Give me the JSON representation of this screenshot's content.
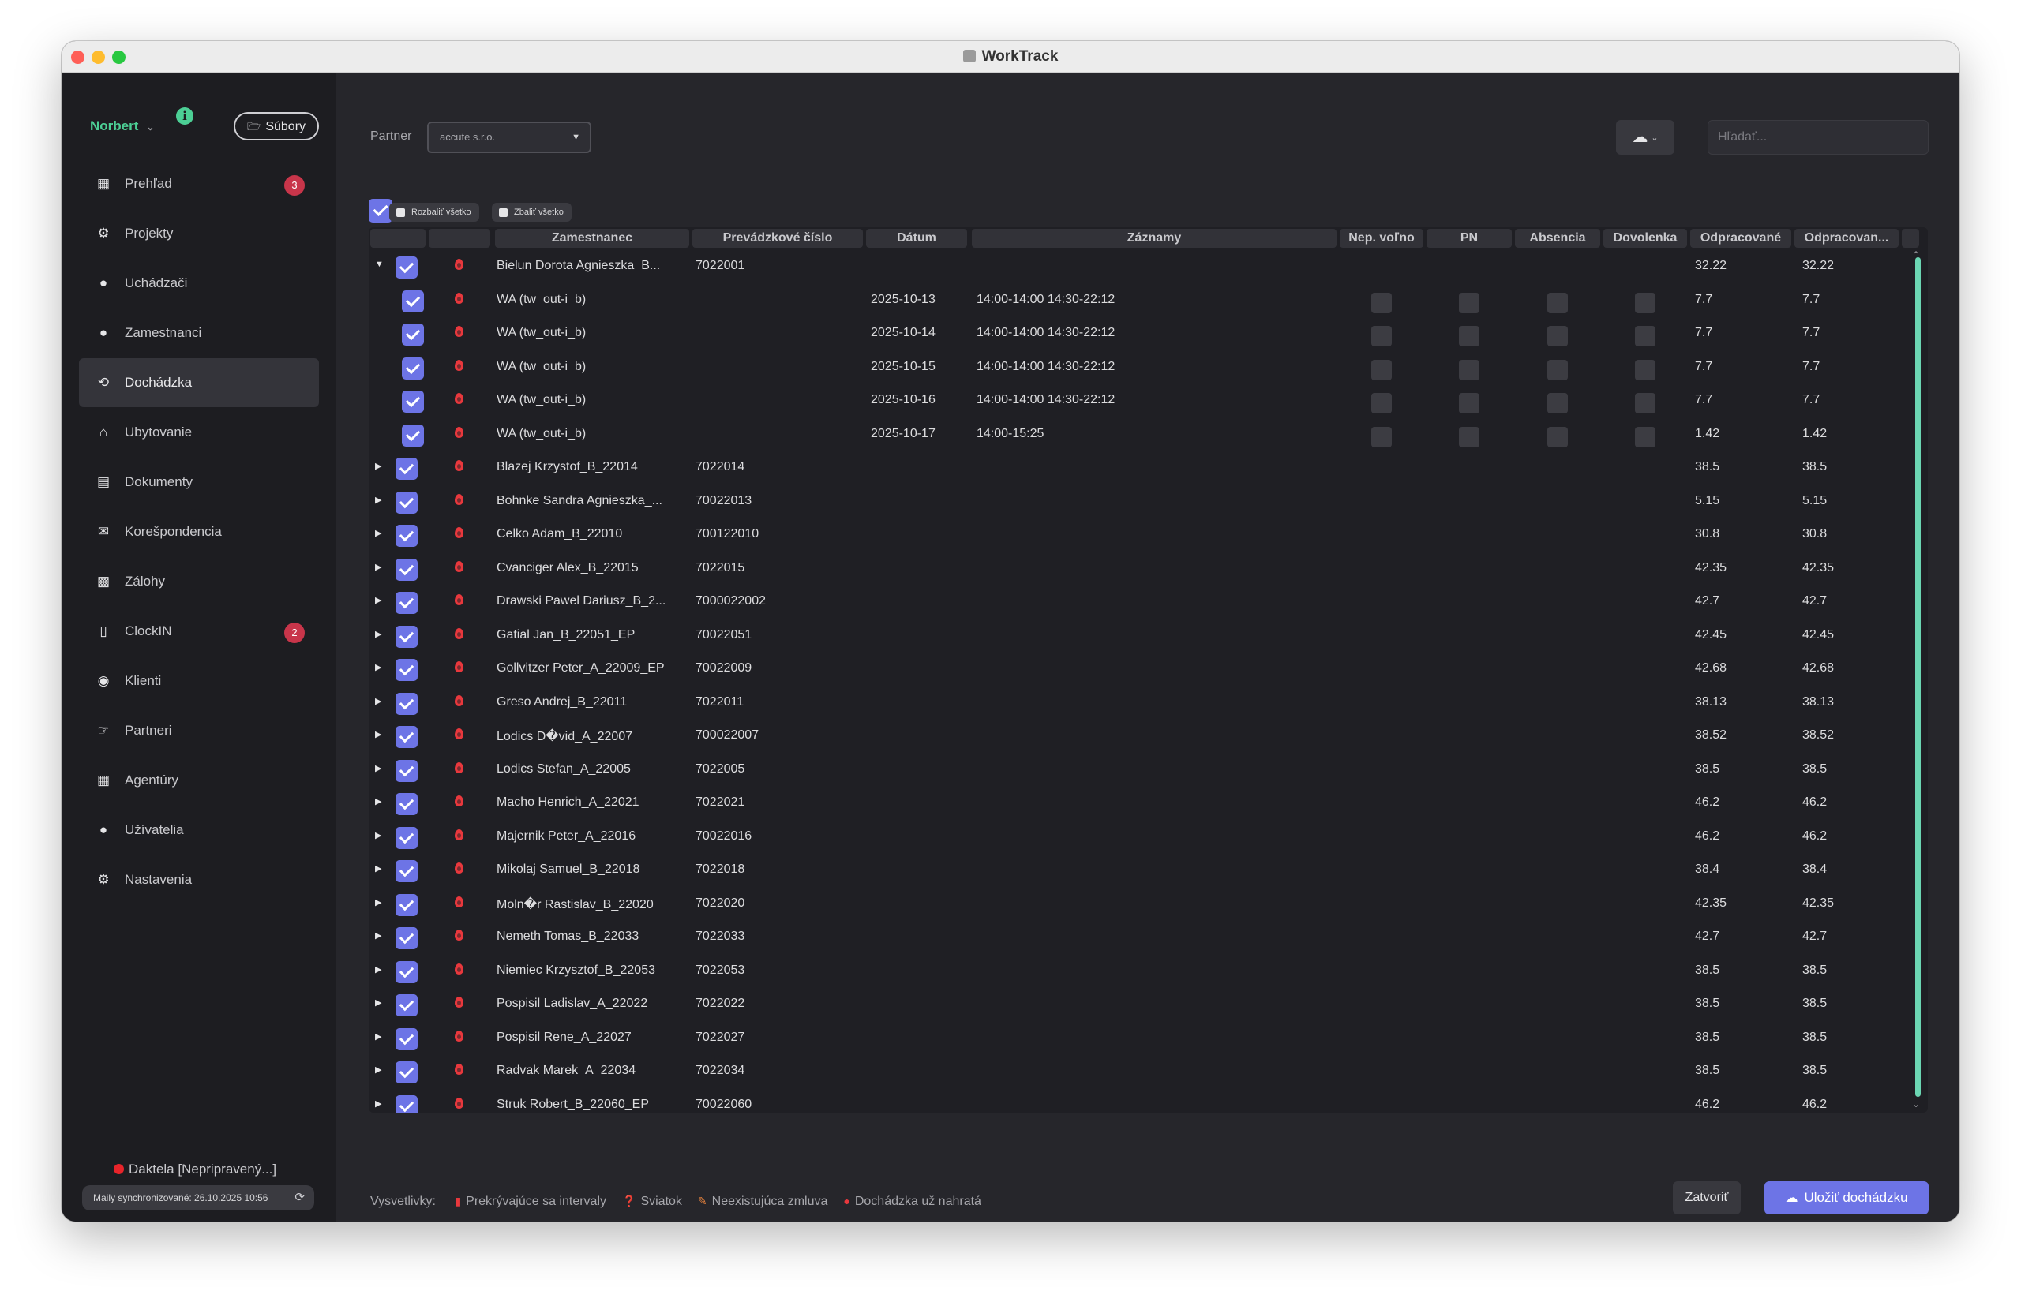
{
  "window": {
    "title": "WorkTrack"
  },
  "sidebar": {
    "user": "Norbert",
    "files_label": "Súbory",
    "items": [
      {
        "label": "Prehľad",
        "icon": "grid-icon",
        "badge": "3",
        "active": false
      },
      {
        "label": "Projekty",
        "icon": "projects-icon",
        "badge": null,
        "active": false
      },
      {
        "label": "Uchádzači",
        "icon": "applicants-icon",
        "badge": null,
        "active": false
      },
      {
        "label": "Zamestnanci",
        "icon": "employees-icon",
        "badge": null,
        "active": false
      },
      {
        "label": "Dochádzka",
        "icon": "history-icon",
        "badge": null,
        "active": true
      },
      {
        "label": "Ubytovanie",
        "icon": "house-icon",
        "badge": null,
        "active": false
      },
      {
        "label": "Dokumenty",
        "icon": "documents-icon",
        "badge": null,
        "active": false
      },
      {
        "label": "Korešpondencia",
        "icon": "mail-icon",
        "badge": null,
        "active": false
      },
      {
        "label": "Zálohy",
        "icon": "money-icon",
        "badge": null,
        "active": false
      },
      {
        "label": "ClockIN",
        "icon": "phone-icon",
        "badge": "2",
        "active": false
      },
      {
        "label": "Klienti",
        "icon": "handshake-icon",
        "badge": null,
        "active": false
      },
      {
        "label": "Partneri",
        "icon": "partner-hand-icon",
        "badge": null,
        "active": false
      },
      {
        "label": "Agentúry",
        "icon": "building-icon",
        "badge": null,
        "active": false
      },
      {
        "label": "Užívatelia",
        "icon": "users-icon",
        "badge": null,
        "active": false
      },
      {
        "label": "Nastavenia",
        "icon": "gears-icon",
        "badge": null,
        "active": false
      }
    ],
    "daktela": "Daktela [Nepripravený...]",
    "sync": "Maily synchronizované: 26.10.2025 10:56"
  },
  "toolbar": {
    "partner_label": "Partner",
    "partner_value": "accute s.r.o.",
    "search_placeholder": "Hľadať..."
  },
  "actions": {
    "expand_all": "Rozbaliť všetko",
    "collapse_all": "Zbaliť všetko"
  },
  "table": {
    "columns": [
      "Zamestnanec",
      "Prevádzkové číslo",
      "Dátum",
      "Záznamy",
      "Nep. voľno",
      "PN",
      "Absencia",
      "Dovolenka",
      "Odpracované",
      "Odpracovan..."
    ],
    "rows": [
      {
        "kind": "parent",
        "expanded": true,
        "name": "Bielun Dorota Agnieszka_B...",
        "number": "7022001",
        "worked": "32.22",
        "worked2": "32.22"
      },
      {
        "kind": "child",
        "name": "WA (tw_out-i_b)",
        "date": "2025-10-13",
        "records": "14:00-14:00 14:30-22:12",
        "worked": "7.7",
        "worked2": "7.7"
      },
      {
        "kind": "child",
        "name": "WA (tw_out-i_b)",
        "date": "2025-10-14",
        "records": "14:00-14:00 14:30-22:12",
        "worked": "7.7",
        "worked2": "7.7"
      },
      {
        "kind": "child",
        "name": "WA (tw_out-i_b)",
        "date": "2025-10-15",
        "records": "14:00-14:00 14:30-22:12",
        "worked": "7.7",
        "worked2": "7.7"
      },
      {
        "kind": "child",
        "name": "WA (tw_out-i_b)",
        "date": "2025-10-16",
        "records": "14:00-14:00 14:30-22:12",
        "worked": "7.7",
        "worked2": "7.7"
      },
      {
        "kind": "child",
        "name": "WA (tw_out-i_b)",
        "date": "2025-10-17",
        "records": "14:00-15:25",
        "worked": "1.42",
        "worked2": "1.42"
      },
      {
        "kind": "parent",
        "expanded": false,
        "name": "Blazej Krzystof_B_22014",
        "number": "7022014",
        "worked": "38.5",
        "worked2": "38.5"
      },
      {
        "kind": "parent",
        "expanded": false,
        "name": "Bohnke Sandra Agnieszka_...",
        "number": "70022013",
        "worked": "5.15",
        "worked2": "5.15"
      },
      {
        "kind": "parent",
        "expanded": false,
        "name": "Celko Adam_B_22010",
        "number": "700122010",
        "worked": "30.8",
        "worked2": "30.8"
      },
      {
        "kind": "parent",
        "expanded": false,
        "name": "Cvanciger Alex_B_22015",
        "number": "7022015",
        "worked": "42.35",
        "worked2": "42.35"
      },
      {
        "kind": "parent",
        "expanded": false,
        "name": "Drawski Pawel Dariusz_B_2...",
        "number": "7000022002",
        "worked": "42.7",
        "worked2": "42.7"
      },
      {
        "kind": "parent",
        "expanded": false,
        "name": "Gatial Jan_B_22051_EP",
        "number": "70022051",
        "worked": "42.45",
        "worked2": "42.45"
      },
      {
        "kind": "parent",
        "expanded": false,
        "name": "Gollvitzer Peter_A_22009_EP",
        "number": "70022009",
        "worked": "42.68",
        "worked2": "42.68"
      },
      {
        "kind": "parent",
        "expanded": false,
        "name": "Greso Andrej_B_22011",
        "number": "7022011",
        "worked": "38.13",
        "worked2": "38.13"
      },
      {
        "kind": "parent",
        "expanded": false,
        "name": "Lodics D�vid_A_22007",
        "number": "700022007",
        "worked": "38.52",
        "worked2": "38.52"
      },
      {
        "kind": "parent",
        "expanded": false,
        "name": "Lodics Stefan_A_22005",
        "number": "7022005",
        "worked": "38.5",
        "worked2": "38.5"
      },
      {
        "kind": "parent",
        "expanded": false,
        "name": "Macho Henrich_A_22021",
        "number": "7022021",
        "worked": "46.2",
        "worked2": "46.2"
      },
      {
        "kind": "parent",
        "expanded": false,
        "name": "Majernik Peter_A_22016",
        "number": "70022016",
        "worked": "46.2",
        "worked2": "46.2"
      },
      {
        "kind": "parent",
        "expanded": false,
        "name": "Mikolaj Samuel_B_22018",
        "number": "7022018",
        "worked": "38.4",
        "worked2": "38.4"
      },
      {
        "kind": "parent",
        "expanded": false,
        "name": "Moln�r Rastislav_B_22020",
        "number": "7022020",
        "worked": "42.35",
        "worked2": "42.35"
      },
      {
        "kind": "parent",
        "expanded": false,
        "name": "Nemeth Tomas_B_22033",
        "number": "7022033",
        "worked": "42.7",
        "worked2": "42.7"
      },
      {
        "kind": "parent",
        "expanded": false,
        "name": "Niemiec Krzysztof_B_22053",
        "number": "7022053",
        "worked": "38.5",
        "worked2": "38.5"
      },
      {
        "kind": "parent",
        "expanded": false,
        "name": "Pospisil Ladislav_A_22022",
        "number": "7022022",
        "worked": "38.5",
        "worked2": "38.5"
      },
      {
        "kind": "parent",
        "expanded": false,
        "name": "Pospisil Rene_A_22027",
        "number": "7022027",
        "worked": "38.5",
        "worked2": "38.5"
      },
      {
        "kind": "parent",
        "expanded": false,
        "name": "Radvak Marek_A_22034",
        "number": "7022034",
        "worked": "38.5",
        "worked2": "38.5"
      },
      {
        "kind": "parent",
        "expanded": false,
        "name": "Struk Robert_B_22060_EP",
        "number": "70022060",
        "worked": "46.2",
        "worked2": "46.2"
      }
    ]
  },
  "legend": {
    "label": "Vysvetlivky:",
    "items": [
      {
        "label": "Prekrývajúce sa intervaly",
        "icon": "overlap-icon",
        "color": "#e8383d"
      },
      {
        "label": "Sviatok",
        "icon": "holiday-icon",
        "color": "#e8833d"
      },
      {
        "label": "Neexistujúca zmluva",
        "icon": "no-contract-icon",
        "color": "#e8833d"
      },
      {
        "label": "Dochádzka už nahratá",
        "icon": "fire-icon",
        "color": "#e8383d"
      }
    ]
  },
  "footer": {
    "close_label": "Zatvoriť",
    "save_label": "Uložiť dochádzku"
  },
  "colors": {
    "accent": "#6d74e6",
    "user": "#4ccf95",
    "badge": "#c8354a",
    "scrollbar": "#6bd6b3"
  }
}
